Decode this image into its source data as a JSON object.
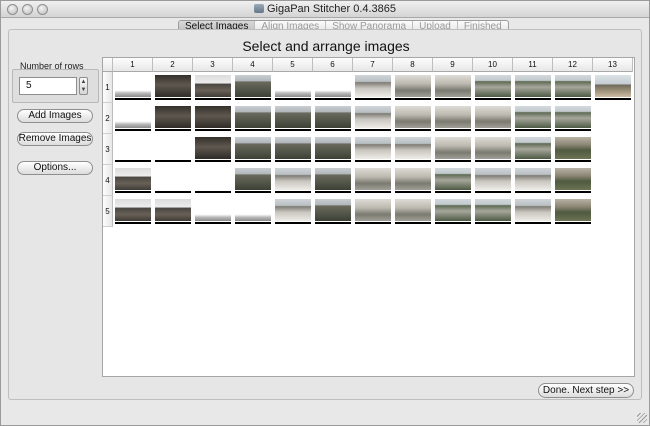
{
  "window": {
    "title": "GigaPan Stitcher 0.4.3865"
  },
  "tabs": [
    {
      "label": "Select Images",
      "active": true
    },
    {
      "label": "Align Images",
      "active": false
    },
    {
      "label": "Show Panorama",
      "active": false
    },
    {
      "label": "Upload",
      "active": false
    },
    {
      "label": "Finished",
      "active": false
    }
  ],
  "main": {
    "heading": "Select and arrange images"
  },
  "sidebar": {
    "rows_label": "Number of rows",
    "rows_value": "5",
    "add_images": "Add Images",
    "remove_images": "Remove Images",
    "options": "Options..."
  },
  "grid": {
    "columns": [
      "1",
      "2",
      "3",
      "4",
      "5",
      "6",
      "7",
      "8",
      "9",
      "10",
      "11",
      "12",
      "13"
    ],
    "rows": [
      "1",
      "2",
      "3",
      "4",
      "5"
    ],
    "tile_styles": {
      "w": "#ffffff",
      "d": "linear-gradient(#34302b 0%, #5e584f 45%, #2f2b27 100%)",
      "df": "linear-gradient(#dcdcdc 0%, #ededed 38%, #494540 40%, #686158 70%, #3f3b36 100%)",
      "m": "linear-gradient(#c9ced1 0%, #b0b6ba 28%, #6b6a5f 30%, #53564a 65%, #3c3f35 100%)",
      "fe": "linear-gradient(#ffffff 0%, #ffffff 70%, #bcbcbc 82%, #8a8a8a 100%)",
      "ro": "linear-gradient(#cfd5d8 0%, #b8bec2 30%, #7d7c73 34%, #c9c6c0 60%, #eeece7 100%)",
      "ru": "linear-gradient(#dedcd6 0%, #bcb9b0 40%, #7a7a70 70%, #a19f98 100%)",
      "tr": "linear-gradient(#d2d8db 0%, #c3cace 25%, #5f6a55 30%, #a7a79b 55%, #4d5a45 100%)",
      "bt": "linear-gradient(#dce3e7 0%, #c6cdd2 40%, #716b5c 46%, #9a8f77 70%, #cdbda3 100%)",
      "rt": "linear-gradient(#b9b3a6 0%, #8c8676 35%, #4f5a40 60%, #6d7355 100%)"
    },
    "tiles": [
      [
        "fe",
        "d",
        "df",
        "m",
        "fe",
        "fe",
        "ro",
        "ru",
        "ru",
        "tr",
        "tr",
        "tr",
        "bt"
      ],
      [
        "fe",
        "d",
        "d",
        "m",
        "m",
        "m",
        "ro",
        "ru",
        "ru",
        "ru",
        "tr",
        "tr",
        ""
      ],
      [
        "w",
        "w",
        "d",
        "m",
        "m",
        "m",
        "ro",
        "ro",
        "ru",
        "ru",
        "tr",
        "rt",
        ""
      ],
      [
        "df",
        "w",
        "w",
        "m",
        "ro",
        "m",
        "ru",
        "ru",
        "tr",
        "ro",
        "ro",
        "rt",
        ""
      ],
      [
        "df",
        "df",
        "fe",
        "fe",
        "ro",
        "m",
        "ru",
        "ru",
        "tr",
        "tr",
        "ro",
        "rt",
        ""
      ]
    ]
  },
  "footer": {
    "done_label": "Done.  Next step >>"
  }
}
